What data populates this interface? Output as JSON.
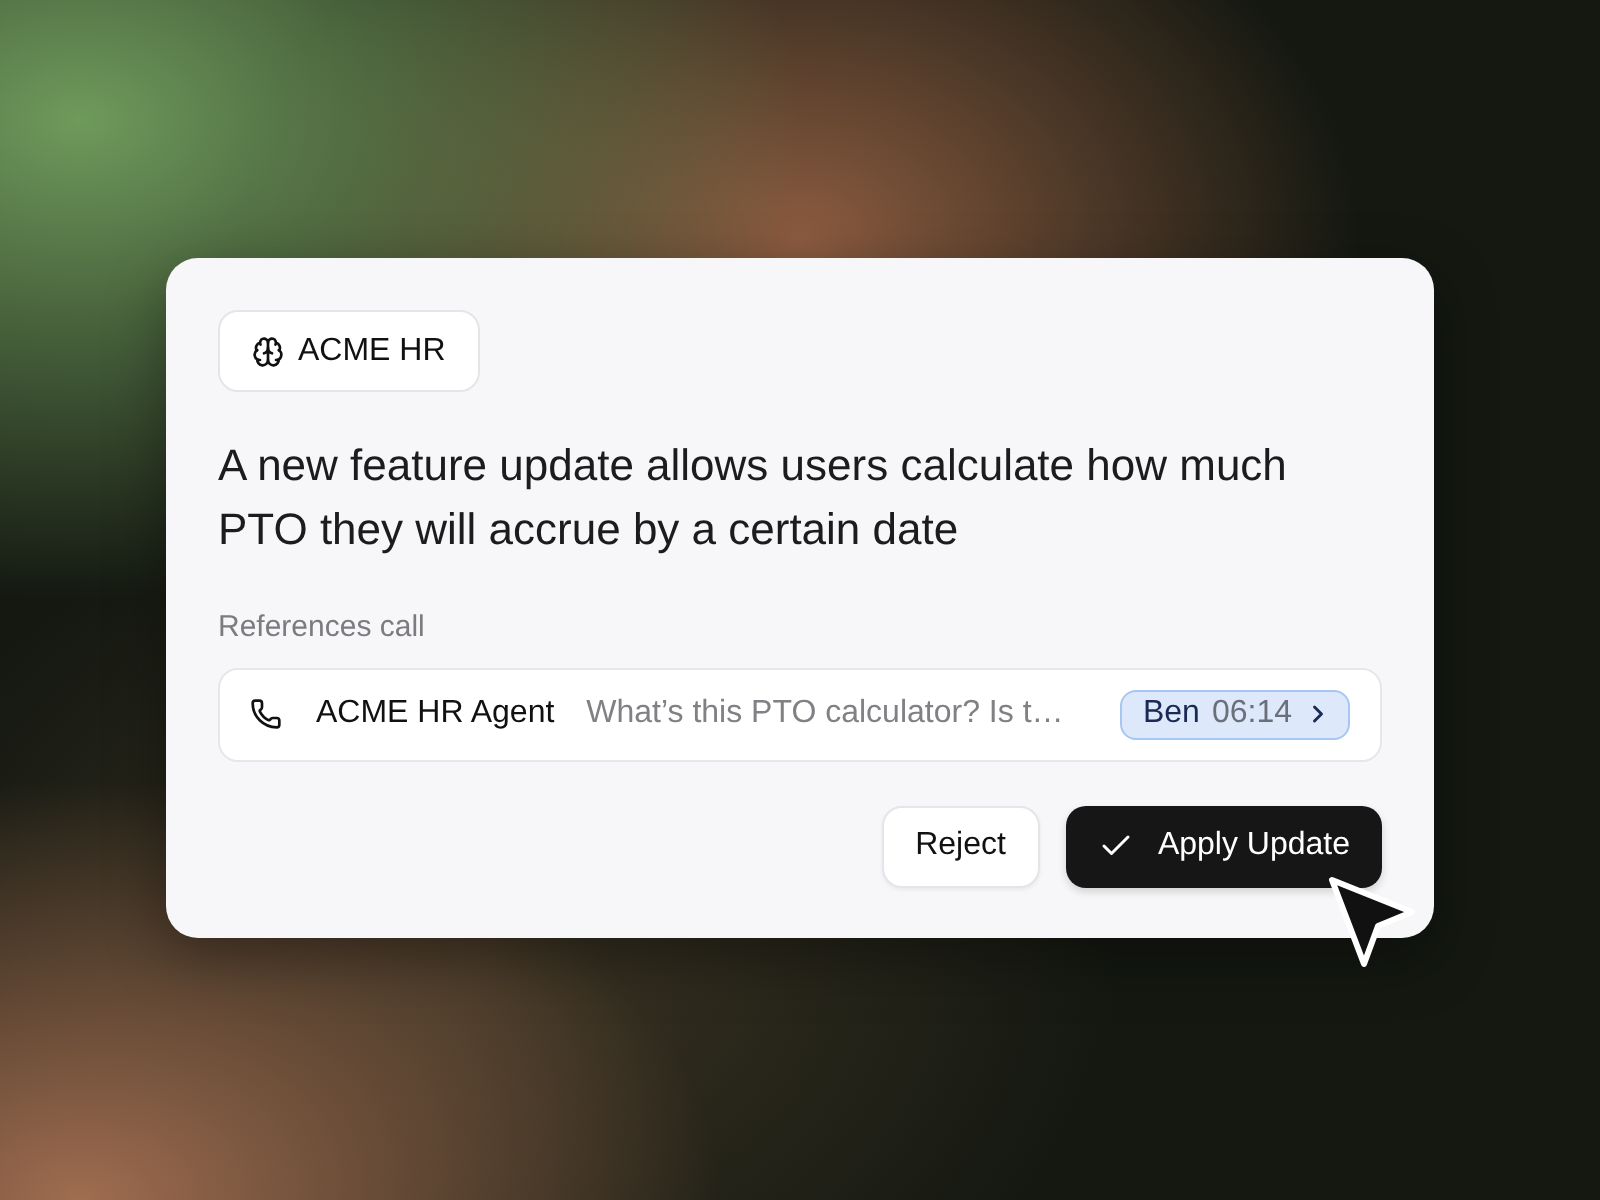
{
  "badge": {
    "label": "ACME HR"
  },
  "message": "A new feature update allows users calculate how much PTO they will accrue by a certain date",
  "reference": {
    "label": "References call",
    "call": {
      "title": "ACME HR Agent",
      "snippet": "What’s this PTO calculator? Is t…",
      "speaker": "Ben",
      "time": "06:14"
    }
  },
  "actions": [
    {
      "label": "Reject",
      "kind": "secondary"
    },
    {
      "label": "Apply Update",
      "kind": "primary"
    }
  ]
}
